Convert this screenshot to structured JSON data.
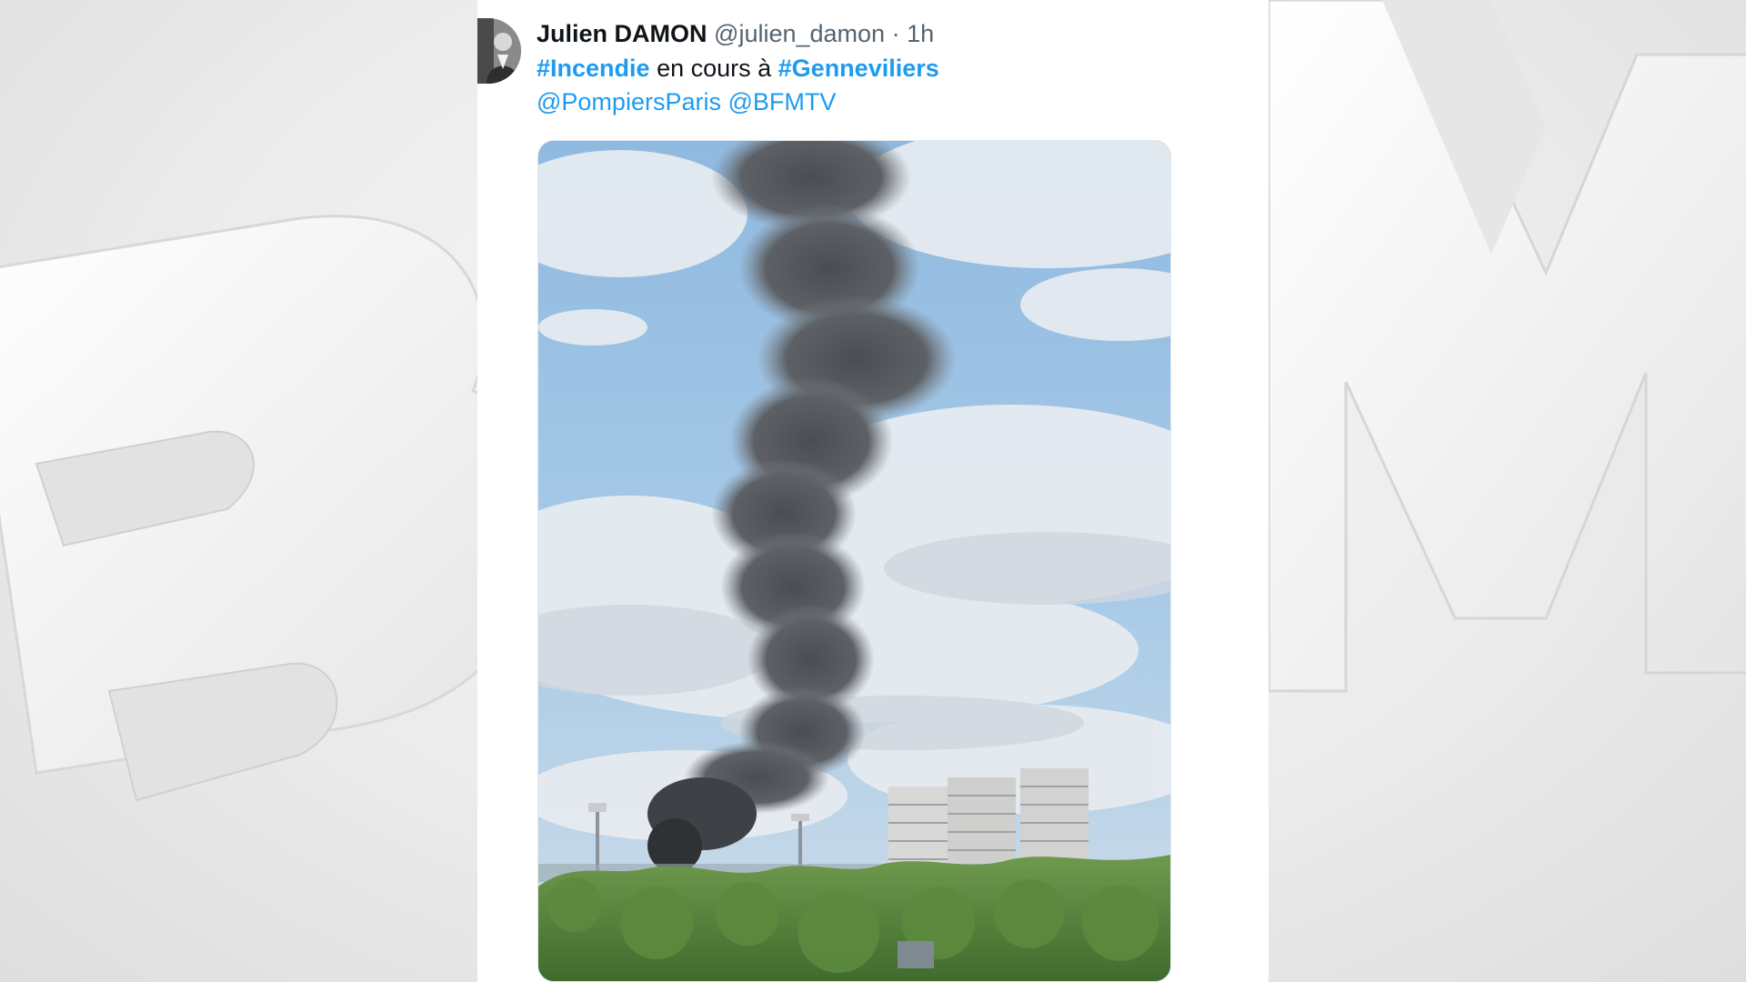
{
  "tweet": {
    "author_name": "Julien DAMON",
    "author_handle": "@julien_damon",
    "separator": "·",
    "time": "1h",
    "hashtag_1": "#Incendie",
    "text_middle": "en cours à",
    "hashtag_2": "#Genneviliers",
    "mention_1": "@PompiersParis",
    "mention_2": "@BFMTV"
  },
  "media": {
    "description_icon": "photo-smoke-plume"
  },
  "colors": {
    "link": "#1d9bf0",
    "text": "#0f1419",
    "secondary": "#536471"
  }
}
